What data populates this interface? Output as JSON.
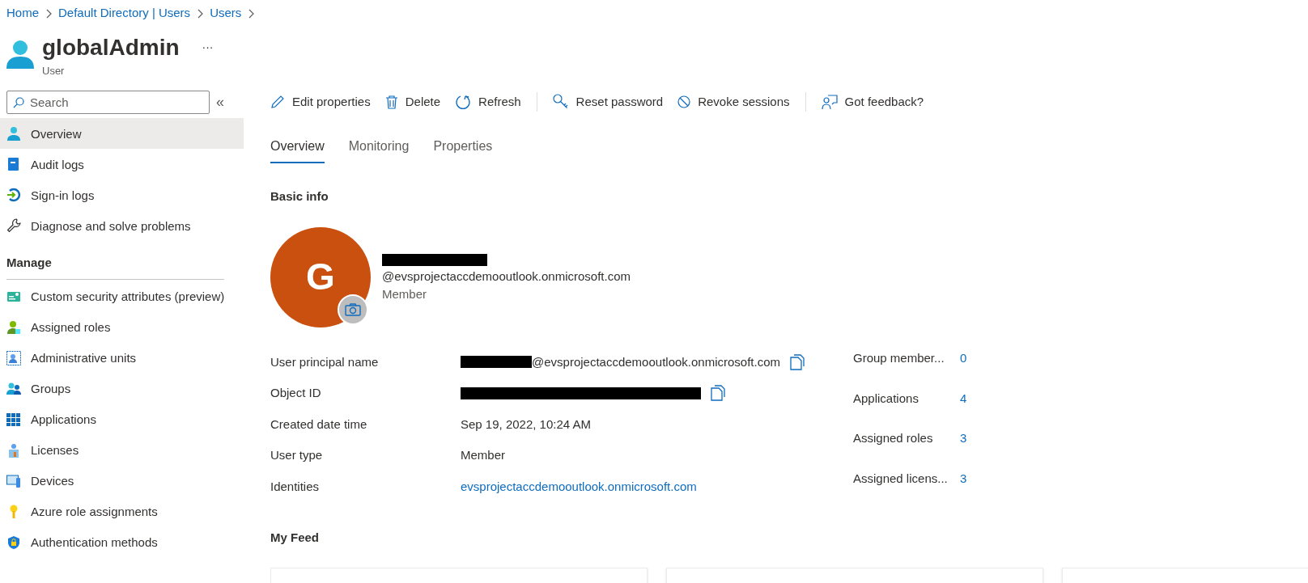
{
  "breadcrumb": [
    "Home",
    "Default Directory | Users",
    "Users"
  ],
  "header": {
    "title": "globalAdmin",
    "subtitle": "User",
    "more": "···"
  },
  "sidebar": {
    "search": {
      "placeholder": "Search"
    },
    "collapse": "«",
    "items": [
      {
        "label": "Overview",
        "selected": true
      },
      {
        "label": "Audit logs",
        "selected": false
      },
      {
        "label": "Sign-in logs",
        "selected": false
      },
      {
        "label": "Diagnose and solve problems",
        "selected": false
      }
    ],
    "section": "Manage",
    "manage_items": [
      {
        "label": "Custom security attributes (preview)",
        "selected": false
      },
      {
        "label": "Assigned roles",
        "selected": false
      },
      {
        "label": "Administrative units",
        "selected": false
      },
      {
        "label": "Groups",
        "selected": false
      },
      {
        "label": "Applications",
        "selected": false
      },
      {
        "label": "Licenses",
        "selected": false
      },
      {
        "label": "Devices",
        "selected": false
      },
      {
        "label": "Azure role assignments",
        "selected": false
      },
      {
        "label": "Authentication methods",
        "selected": false
      }
    ]
  },
  "toolbar": [
    {
      "kind": "button",
      "label": "Edit properties"
    },
    {
      "kind": "button",
      "label": "Delete"
    },
    {
      "kind": "button",
      "label": "Refresh"
    },
    {
      "kind": "divider"
    },
    {
      "kind": "button",
      "label": "Reset password"
    },
    {
      "kind": "button",
      "label": "Revoke sessions"
    },
    {
      "kind": "divider"
    },
    {
      "kind": "button",
      "label": "Got feedback?"
    }
  ],
  "tabs": [
    {
      "label": "Overview",
      "selected": true
    },
    {
      "label": "Monitoring",
      "selected": false
    },
    {
      "label": "Properties",
      "selected": false
    }
  ],
  "basic_info": {
    "heading": "Basic info",
    "avatar": {
      "initial": "G"
    },
    "name": {
      "redacted": true
    },
    "email": {
      "text": "@evsprojectaccdemooutlook.onmicrosoft.com",
      "redacted": true
    },
    "type": "Member",
    "fields": [
      {
        "kind": "text",
        "label": "User principal name",
        "value": "@evsprojectaccdemooutlook.onmicrosoft.com",
        "redacted": true,
        "copy": true
      },
      {
        "kind": "text",
        "label": "Object ID",
        "redacted": true,
        "copy": true
      },
      {
        "kind": "text",
        "label": "Created date time",
        "value": "Sep 19, 2022, 10:24 AM",
        "redacted": false,
        "copy": false
      },
      {
        "kind": "text",
        "label": "User type",
        "value": "Member",
        "redacted": false,
        "copy": false
      },
      {
        "kind": "link",
        "label": "Identities",
        "value": "evsprojectaccdemooutlook.onmicrosoft.com",
        "redacted": false,
        "copy": false
      }
    ],
    "stats": [
      {
        "label": "Group member...",
        "value": "0"
      },
      {
        "label": "Applications",
        "value": "4"
      },
      {
        "label": "Assigned roles",
        "value": "3"
      },
      {
        "label": "Assigned licens...",
        "value": "3"
      }
    ]
  },
  "feed": {
    "heading": "My Feed"
  }
}
